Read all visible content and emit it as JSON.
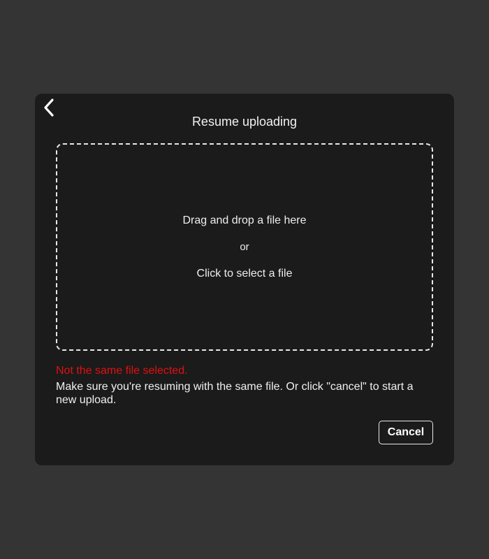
{
  "modal": {
    "back_icon": "chevron-left-icon",
    "title": "Resume uploading",
    "dropzone": {
      "line1": "Drag and drop a file here",
      "line2": "or",
      "line3": "Click to select a file"
    },
    "error": {
      "title": "Not the same file selected.",
      "message": "Make sure you're resuming with the same file. Or click \"cancel\" to start a new upload."
    },
    "cancel_label": "Cancel"
  },
  "colors": {
    "page_background": "#343434",
    "modal_background": "#1b1b1b",
    "error": "#e01010",
    "text": "#ffffff"
  }
}
